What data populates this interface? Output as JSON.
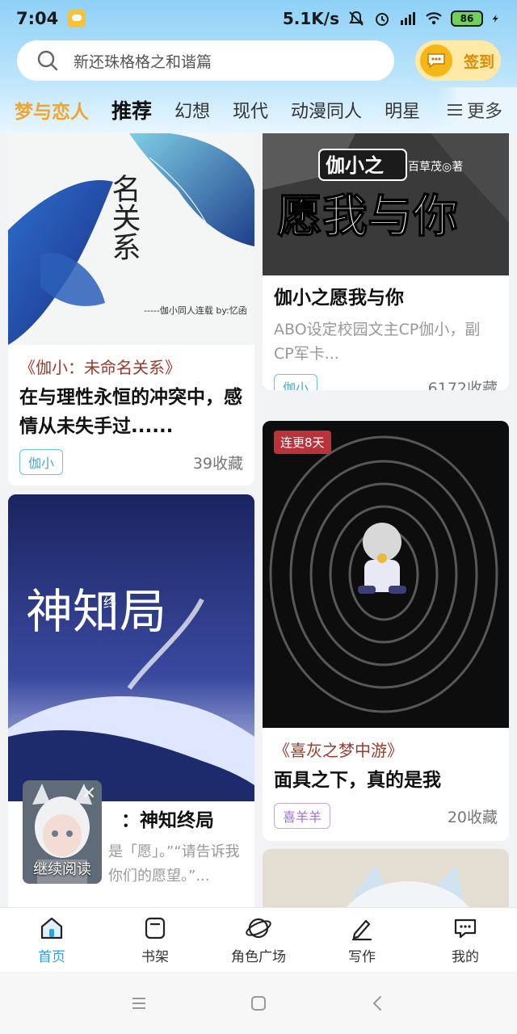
{
  "status_bar": {
    "time": "7:04",
    "net_speed": "5.1K/s",
    "battery": "86"
  },
  "search": {
    "placeholder": "新还珠格格之和谐篇",
    "signin_label": "签到"
  },
  "tabs": [
    {
      "label": "梦与恋人"
    },
    {
      "label": "推荐"
    },
    {
      "label": "幻想"
    },
    {
      "label": "现代"
    },
    {
      "label": "动漫同人"
    },
    {
      "label": "明星"
    }
  ],
  "more_label": "更多",
  "cards": [
    {
      "category": "《伽小：未命名关系》",
      "title": "在与理性永恒的冲突中，感情从未失手过......",
      "tag": "伽小",
      "count": "39收藏",
      "cover_text": "名关系",
      "cover_subtext": "-----伽小同人连载  by:忆函"
    },
    {
      "title": "伽小之愿我与你",
      "desc": "ABO设定校园文主CP伽小，副CP军卡...",
      "tag": "伽小",
      "count": "6172收藏",
      "cover_text_small": "伽小之",
      "cover_text_author": "百草茂◎著",
      "cover_text_big": "愿我与你"
    },
    {
      "badge": "连更8天",
      "category": "《喜灰之梦中游》",
      "title": "面具之下，真的是我",
      "tag": "喜羊羊",
      "count": "20收藏"
    },
    {
      "title_partial": "：神知终局",
      "desc_partial": "是「愿」。”“请告诉我你们的愿望。”...",
      "cover_text": "神知局",
      "cover_small": "终"
    }
  ],
  "floating": {
    "label": "继续阅读"
  },
  "bottom_nav": [
    {
      "label": "首页",
      "icon": "home-icon"
    },
    {
      "label": "书架",
      "icon": "bookshelf-icon"
    },
    {
      "label": "角色广场",
      "icon": "planet-icon"
    },
    {
      "label": "写作",
      "icon": "pencil-icon"
    },
    {
      "label": "我的",
      "icon": "chat-bubble-icon"
    }
  ]
}
